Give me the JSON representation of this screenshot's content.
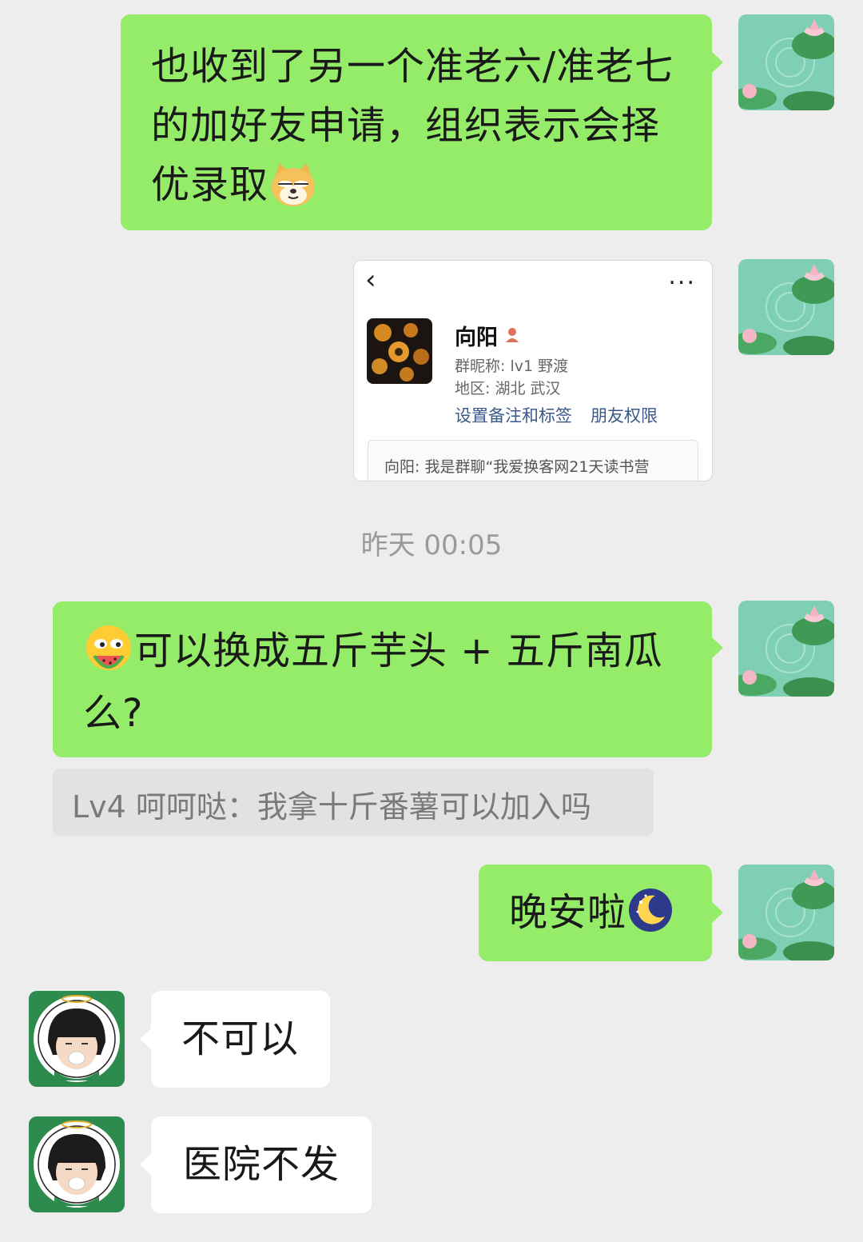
{
  "messages": [
    {
      "text": "也收到了另一个准老六/准老七的加好友申请，组织表示会择优录取",
      "emoji": "doge-icon"
    },
    {
      "type": "profile_card",
      "card": {
        "name": "向阳",
        "nickname_line": "群昵称: lv1 野渡",
        "region_line": "地区: 湖北 武汉",
        "link_remark": "设置备注和标签",
        "link_permission": "朋友权限",
        "request_text": "向阳: 我是群聊“我爱换客网21天读书营",
        "more": "..."
      }
    },
    {
      "text": "可以换成五斤芋头 + 五斤南瓜么?",
      "emoji": "eating-watermelon-icon"
    },
    {
      "text": "晚安啦",
      "emoji": "moon-night-icon"
    },
    {
      "text": "不可以"
    },
    {
      "text": "医院不发"
    }
  ],
  "timestamp": "昨天 00:05",
  "quote": "Lv4 呵呵哒：我拿十斤番薯可以加入吗",
  "colors": {
    "bg": "#ededed",
    "sent_bubble": "#95ec69",
    "received_bubble": "#ffffff",
    "link": "#3a5a8c"
  }
}
